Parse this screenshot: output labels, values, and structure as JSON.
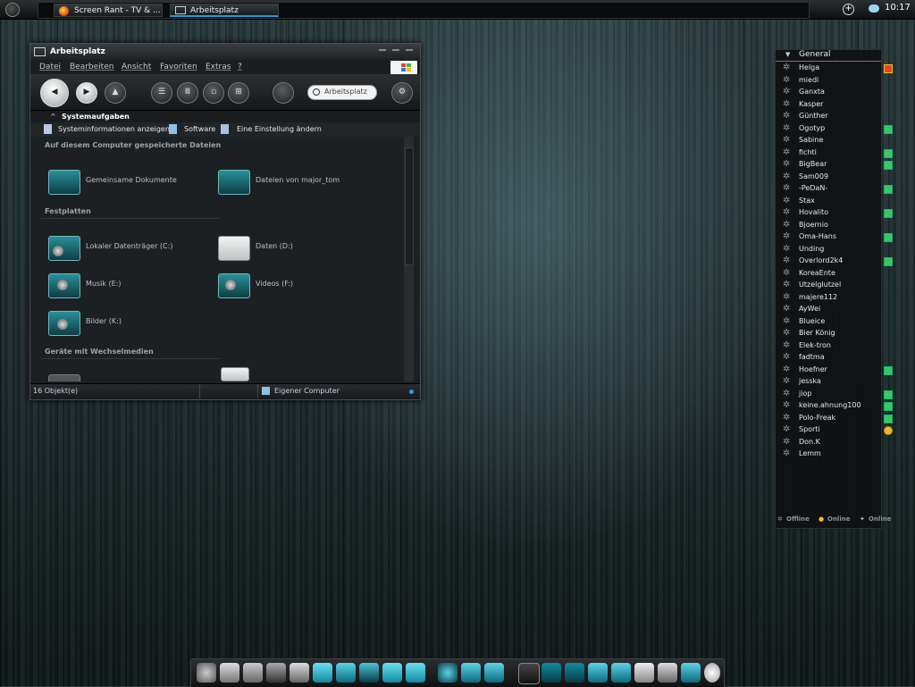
{
  "taskbar": {
    "tasks": [
      {
        "label": "Screen Rant - TV & ...",
        "icon": "firefox-icon"
      },
      {
        "label": "Arbeitsplatz",
        "icon": "computer-icon"
      }
    ],
    "clock": "10:17"
  },
  "window": {
    "title": "Arbeitsplatz",
    "menu": [
      "Datei",
      "Bearbeiten",
      "Ansicht",
      "Favoriten",
      "Extras",
      "?"
    ],
    "search_placeholder": "Arbeitsplatz",
    "system_tasks": {
      "header": "Systemaufgaben",
      "items": [
        "Systeminformationen anzeigen",
        "Software",
        "Eine Einstellung ändern"
      ]
    },
    "sections": [
      {
        "title": "Auf diesem Computer gespeicherte Dateien",
        "items": [
          "Gemeinsame Dokumente",
          "Dateien von major_tom"
        ]
      },
      {
        "title": "Festplatten",
        "items": [
          "Lokaler Datenträger (C:)",
          "Daten (D:)",
          "Musik (E:)",
          "Videos (F:)",
          "Bilder (K:)"
        ]
      },
      {
        "title": "Geräte mit Wechselmedien",
        "items": []
      }
    ],
    "status": {
      "count": "16 Objekt(e)",
      "location": "Eigener Computer"
    }
  },
  "contacts": {
    "group": "General",
    "list": [
      {
        "name": "Helga",
        "badge": "star-flower"
      },
      {
        "name": "miedi",
        "badge": ""
      },
      {
        "name": "Ganxta",
        "badge": ""
      },
      {
        "name": "Kasper",
        "badge": ""
      },
      {
        "name": "Günther",
        "badge": ""
      },
      {
        "name": "Ogotyp",
        "badge": "green"
      },
      {
        "name": "Sabine",
        "badge": ""
      },
      {
        "name": "fichti",
        "badge": "green"
      },
      {
        "name": "BigBear",
        "badge": "green"
      },
      {
        "name": "Sam009",
        "badge": ""
      },
      {
        "name": "-PeDaN-",
        "badge": "green"
      },
      {
        "name": "Stax",
        "badge": ""
      },
      {
        "name": "Hovalito",
        "badge": "green"
      },
      {
        "name": "Bjoernio",
        "badge": ""
      },
      {
        "name": "Oma-Hans",
        "badge": "green"
      },
      {
        "name": "Unding",
        "badge": ""
      },
      {
        "name": "Overlord2k4",
        "badge": "green"
      },
      {
        "name": "KoreaEnte",
        "badge": ""
      },
      {
        "name": "Utzelglutzel",
        "badge": ""
      },
      {
        "name": "majere112",
        "badge": ""
      },
      {
        "name": "AyWei",
        "badge": ""
      },
      {
        "name": "Blueice",
        "badge": ""
      },
      {
        "name": "Bier König",
        "badge": ""
      },
      {
        "name": "Elek-tron",
        "badge": ""
      },
      {
        "name": "fadtma",
        "badge": ""
      },
      {
        "name": "Hoefner",
        "badge": "green"
      },
      {
        "name": "jesska",
        "badge": ""
      },
      {
        "name": "jiop",
        "badge": "green"
      },
      {
        "name": "keine.ahnung100",
        "badge": "green"
      },
      {
        "name": "Polo-Freak",
        "badge": "green"
      },
      {
        "name": "Sporti",
        "badge": "star"
      },
      {
        "name": "Don.K",
        "badge": ""
      },
      {
        "name": "Lemm",
        "badge": ""
      }
    ],
    "footer": [
      "Offline",
      "Online",
      "Online"
    ]
  },
  "colors": {
    "accent": "#1e9bd7",
    "teal": "#2a8f98",
    "online": "#3cc46a"
  }
}
